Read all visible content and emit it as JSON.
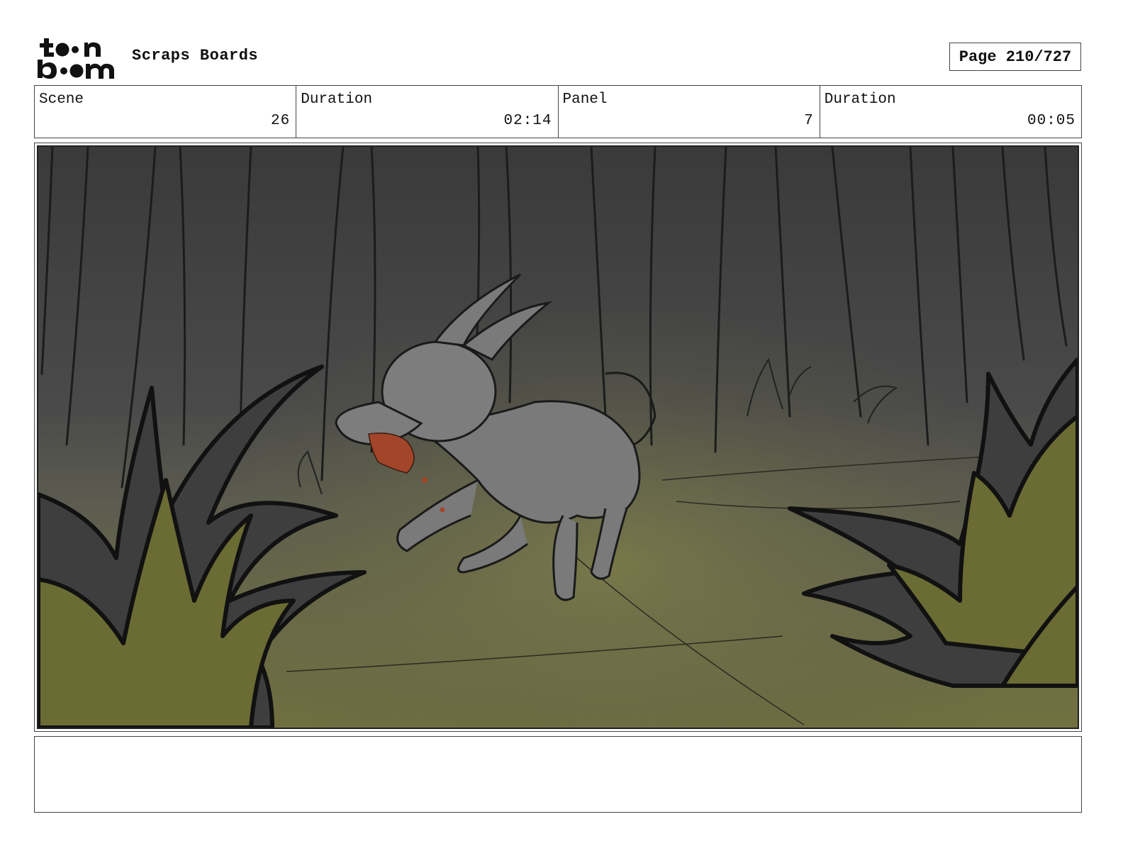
{
  "header": {
    "logo_text": "toon boom",
    "title": "Scraps Boards",
    "page_label": "Page 210/727"
  },
  "info": {
    "scene_label": "Scene",
    "scene_value": "26",
    "scene_duration_label": "Duration",
    "scene_duration_value": "02:14",
    "panel_label": "Panel",
    "panel_value": "7",
    "panel_duration_label": "Duration",
    "panel_duration_value": "00:05"
  },
  "panel": {
    "image": "storyboard-sketch"
  },
  "notes": {
    "text": ""
  },
  "colors": {
    "border": "#444444",
    "forest_dark": "#3f3f3f",
    "ground_olive": "#6f6f3e",
    "plant_olive": "#6b6b34",
    "collar_red": "#a3452a"
  }
}
